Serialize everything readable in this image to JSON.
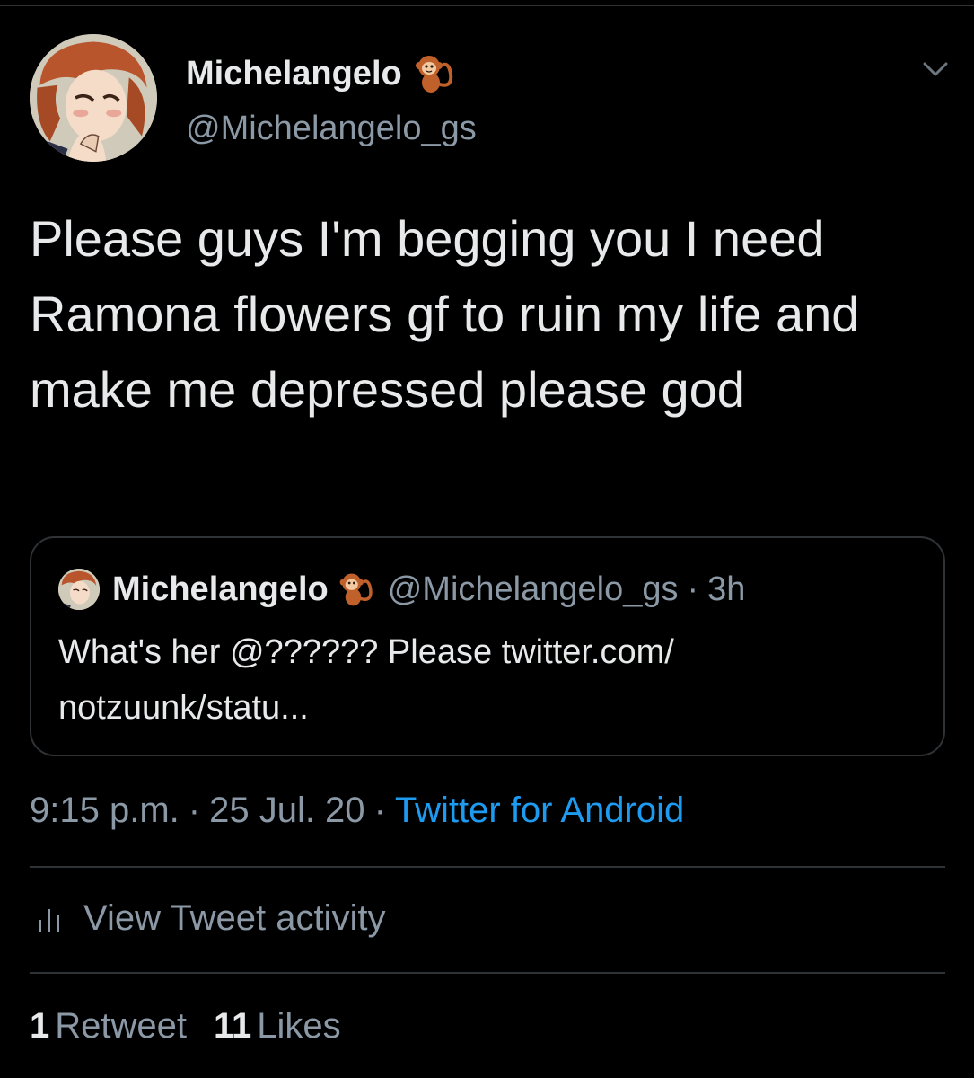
{
  "tweet": {
    "author": {
      "display_name": "Michelangelo",
      "handle": "@Michelangelo_gs",
      "name_badge_icon": "monkey-emoji-icon"
    },
    "text": "Please guys I'm begging you I need Ramona flowers gf to ruin my life and make me depressed please god",
    "quoted": {
      "display_name": "Michelangelo",
      "handle": "@Michelangelo_gs",
      "separator": "·",
      "time": "3h",
      "text_line1": "What's her @?????? Please twitter.com/",
      "text_line2": "notzuunk/statu..."
    },
    "meta": {
      "time": "9:15 p.m.",
      "separator": "·",
      "date": "25 Jul. 20",
      "source": "Twitter for Android"
    },
    "activity_label": "View Tweet activity",
    "stats": {
      "retweets_count": "1",
      "retweets_label": "Retweet",
      "likes_count": "11",
      "likes_label": "Likes"
    }
  },
  "colors": {
    "background": "#000000",
    "text_primary": "#e7e9ea",
    "text_secondary": "#8b98a5",
    "link": "#1d9bf0",
    "border": "#2f3336"
  }
}
